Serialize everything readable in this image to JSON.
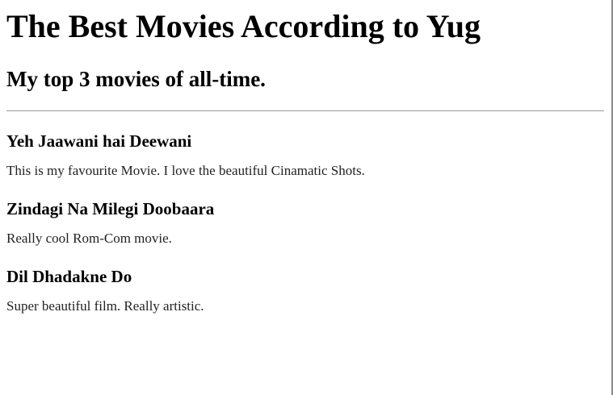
{
  "page": {
    "title": "The Best Movies According to Yug",
    "subtitle": "My top 3 movies of all-time."
  },
  "movies": [
    {
      "title": "Yeh Jaawani hai Deewani",
      "description": "This is my favourite Movie. I love the beautiful Cinamatic Shots."
    },
    {
      "title": "Zindagi Na Milegi Doobaara",
      "description": "Really cool Rom-Com movie."
    },
    {
      "title": "Dil Dhadakne Do",
      "description": "Super beautiful film. Really artistic."
    }
  ]
}
